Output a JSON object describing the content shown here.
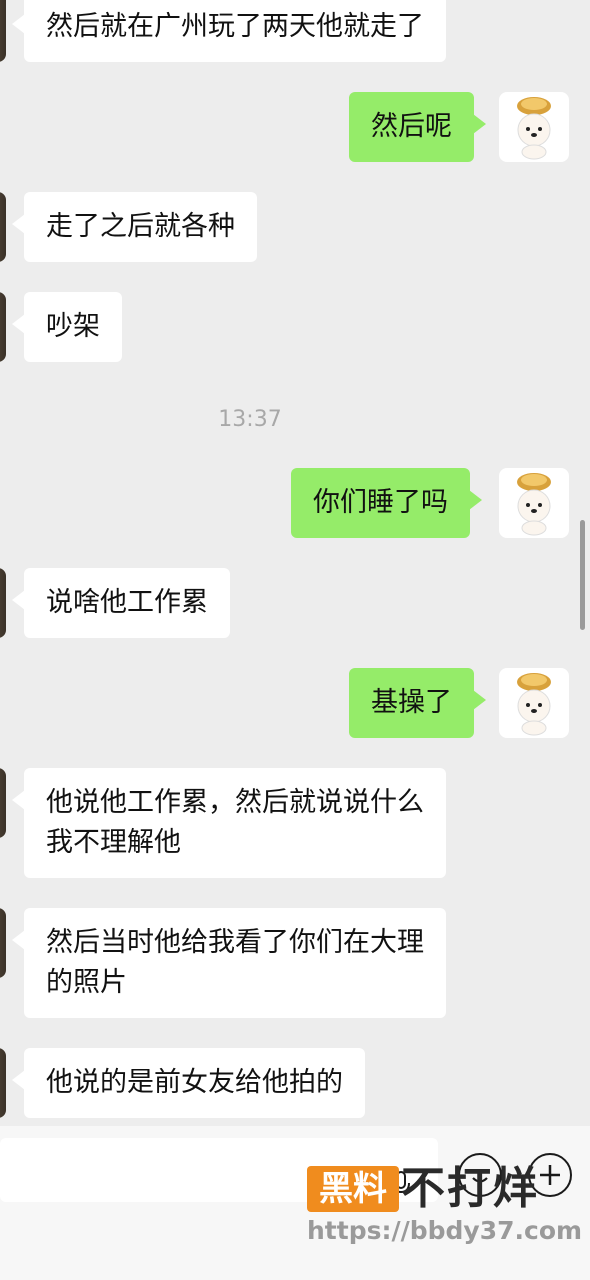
{
  "messages": [
    {
      "dir": "in",
      "text": "然后就在广州玩了两天他就走了"
    },
    {
      "dir": "out",
      "text": "然后呢"
    },
    {
      "dir": "in",
      "text": "走了之后就各种"
    },
    {
      "dir": "in",
      "text": "吵架"
    },
    {
      "dir": "time",
      "text": "13:37"
    },
    {
      "dir": "out",
      "text": "你们睡了吗"
    },
    {
      "dir": "in",
      "text": "说啥他工作累"
    },
    {
      "dir": "out",
      "text": "基操了"
    },
    {
      "dir": "in",
      "line1": "他说他工作累，然后就说说什么",
      "line2": "我不理解他"
    },
    {
      "dir": "in",
      "line1": "然后当时他给我看了你们在大理",
      "line2": "的照片"
    },
    {
      "dir": "in",
      "text": "他说的是前女友给他拍的"
    }
  ],
  "input_bar": {
    "emoji_icon": "smiley-icon",
    "plus_icon": "plus-icon",
    "voice_icon": "microphone-icon"
  },
  "watermark": {
    "badge": "黑料",
    "title": "不打烊",
    "url": "https://bbdy37.com",
    "badge_color": "#f08c1e"
  },
  "colors": {
    "background": "#ededed",
    "incoming_bubble": "#ffffff",
    "outgoing_bubble": "#95ec69"
  }
}
